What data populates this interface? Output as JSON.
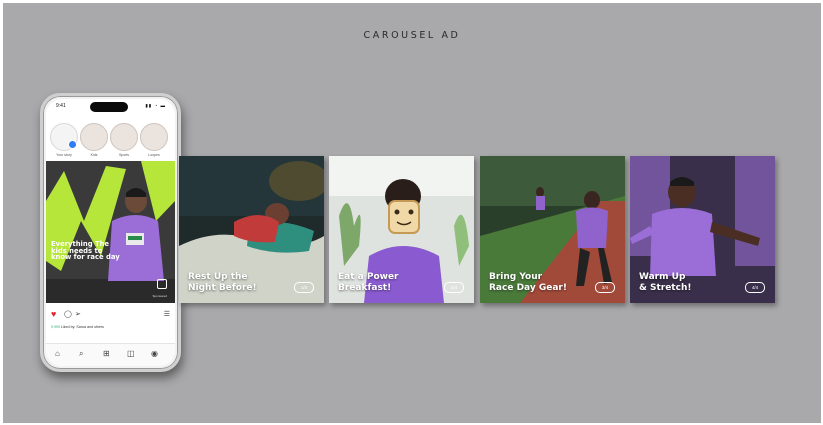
{
  "title": "CAROUSEL AD",
  "phone": {
    "status_time": "9:41",
    "status_icons": "▮▮ ◔ ▬",
    "stories": [
      {
        "name": "Your story",
        "own": true
      },
      {
        "name": "Kids",
        "own": false
      },
      {
        "name": "Sports",
        "own": false
      },
      {
        "name": "Loopes",
        "own": false
      }
    ],
    "post": {
      "caption": "Everything The kids needs to know for race day",
      "credit": "Sponsored"
    },
    "actions": {
      "heart": "♥",
      "comment": "◯",
      "share": "➢",
      "save": "☰"
    },
    "likes_text": "Liked by: Saroa and others",
    "likes_prefix": "9,999",
    "nav": [
      "⌂",
      "⌕",
      "⊞",
      "◫",
      "◉"
    ]
  },
  "slides": [
    {
      "caption": "Rest Up the\nNight Before!",
      "badge": "1/4"
    },
    {
      "caption": "Eat a Power\nBreakfast!",
      "badge": "2/4"
    },
    {
      "caption": "Bring Your\nRace Day Gear!",
      "badge": "3/4"
    },
    {
      "caption": "Warm Up\n& Stretch!",
      "badge": "4/4"
    }
  ],
  "colors": {
    "background": "#a9a8aa",
    "accent_lime": "#b7e63a",
    "jersey_purple": "#9b6dd6",
    "heart_red": "#e0242a",
    "story_plus_blue": "#2e7cf6"
  }
}
